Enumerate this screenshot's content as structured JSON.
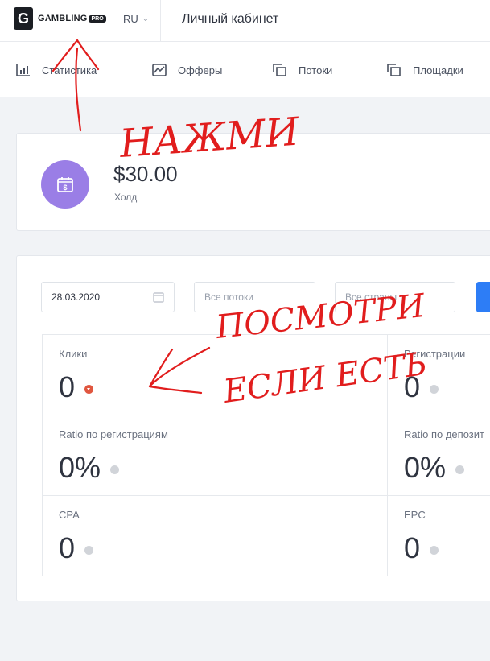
{
  "header": {
    "brand": "GAMBLING",
    "brand_suffix": "PRO",
    "language": "RU",
    "page_title": "Личный кабинет"
  },
  "nav": {
    "items": [
      {
        "label": "Статистика",
        "icon": "bar-chart-icon"
      },
      {
        "label": "Офферы",
        "icon": "line-chart-icon"
      },
      {
        "label": "Потоки",
        "icon": "copy-icon"
      },
      {
        "label": "Площадки",
        "icon": "copy-icon"
      }
    ]
  },
  "balance": {
    "amount": "$30.00",
    "label": "Холд",
    "icon": "calendar-dollar-icon",
    "icon_color": "#9a7ee6"
  },
  "filters": {
    "date": "28.03.2020",
    "streams_placeholder": "Все потоки",
    "countries_placeholder": "Все страны"
  },
  "stats": {
    "clicks": {
      "label": "Клики",
      "value": "0"
    },
    "registrations": {
      "label": "Регистрации",
      "value": "0"
    },
    "ratio_registrations": {
      "label": "Ratio по регистрациям",
      "value": "0%"
    },
    "ratio_deposits": {
      "label": "Ratio по депозит",
      "value": "0%"
    },
    "cpa": {
      "label": "CPA",
      "value": "0"
    },
    "epc": {
      "label": "EPC",
      "value": "0"
    }
  },
  "annotations": {
    "note_top": "НАЖМИ",
    "note_bottom_1": "ПОСМОТРИ",
    "note_bottom_2": "ЕСЛИ ЕСТЬ",
    "color": "#e11d1d"
  },
  "colors": {
    "accent": "#2d7df6",
    "down_indicator": "#e0563f"
  }
}
